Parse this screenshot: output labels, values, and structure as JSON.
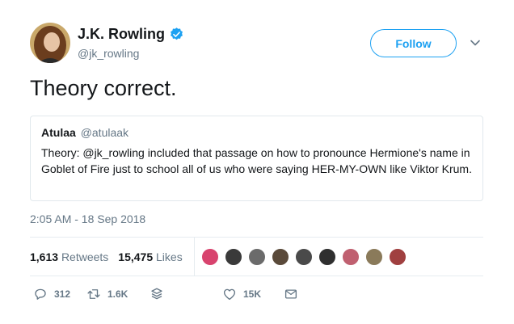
{
  "author": {
    "name": "J.K. Rowling",
    "handle": "@jk_rowling",
    "verified_icon": "verified-badge-icon"
  },
  "follow_label": "Follow",
  "tweet_text": "Theory correct.",
  "quoted_tweet": {
    "name": "Atulaa",
    "handle": "@atulaak",
    "text": "Theory: @jk_rowling included that passage on how to pronounce Hermione's name in Goblet of Fire just to school all of us who were saying HER-MY-OWN like Viktor Krum."
  },
  "timestamp": "2:05 AM - 18 Sep 2018",
  "stats": {
    "retweets_count": "1,613",
    "retweets_label": "Retweets",
    "likes_count": "15,475",
    "likes_label": "Likes"
  },
  "likers": [
    {
      "color": "#d8436e"
    },
    {
      "color": "#3a3a3a"
    },
    {
      "color": "#6b6b6b"
    },
    {
      "color": "#5a4a3a"
    },
    {
      "color": "#4a4a4a"
    },
    {
      "color": "#2f2f2f"
    },
    {
      "color": "#c06070"
    },
    {
      "color": "#8a7a5a"
    },
    {
      "color": "#a04040"
    }
  ],
  "actions": {
    "reply_count": "312",
    "retweet_count": "1.6K",
    "like_count": "15K"
  },
  "colors": {
    "accent": "#1da1f2",
    "text": "#14171a",
    "muted": "#657786",
    "border": "#e1e8ed"
  }
}
